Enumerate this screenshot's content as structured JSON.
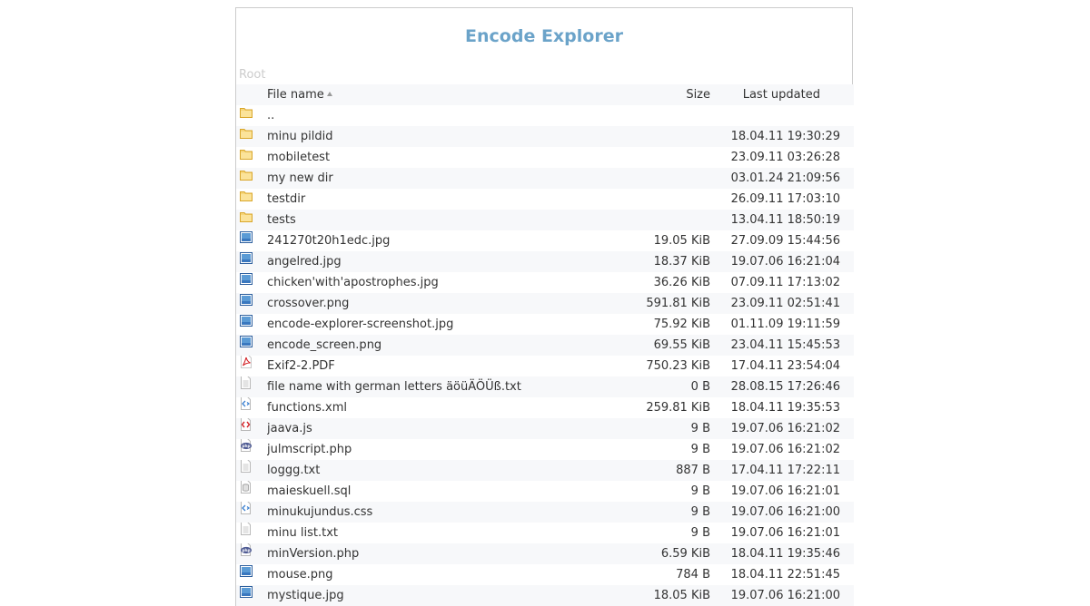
{
  "app": {
    "title": "Encode Explorer"
  },
  "breadcrumb": {
    "root_label": "Root"
  },
  "table": {
    "columns": {
      "name": "File name",
      "size": "Size",
      "date": "Last updated"
    },
    "sort_column": "name",
    "sort_direction": "asc",
    "rows": [
      {
        "icon": "folder-icon",
        "name": "..",
        "size": "",
        "date": ""
      },
      {
        "icon": "folder-icon",
        "name": "minu pildid",
        "size": "",
        "date": "18.04.11 19:30:29"
      },
      {
        "icon": "folder-icon",
        "name": "mobiletest",
        "size": "",
        "date": "23.09.11 03:26:28"
      },
      {
        "icon": "folder-icon",
        "name": "my new dir",
        "size": "",
        "date": "03.01.24 21:09:56"
      },
      {
        "icon": "folder-icon",
        "name": "testdir",
        "size": "",
        "date": "26.09.11 17:03:10"
      },
      {
        "icon": "folder-icon",
        "name": "tests",
        "size": "",
        "date": "13.04.11 18:50:19"
      },
      {
        "icon": "image-file-icon",
        "name": "241270t20h1edc.jpg",
        "size": "19.05 KiB",
        "date": "27.09.09 15:44:56"
      },
      {
        "icon": "image-file-icon",
        "name": "angelred.jpg",
        "size": "18.37 KiB",
        "date": "19.07.06 16:21:04"
      },
      {
        "icon": "image-file-icon",
        "name": "chicken'with'apostrophes.jpg",
        "size": "36.26 KiB",
        "date": "07.09.11 17:13:02"
      },
      {
        "icon": "image-file-icon",
        "name": "crossover.png",
        "size": "591.81 KiB",
        "date": "23.09.11 02:51:41"
      },
      {
        "icon": "image-file-icon",
        "name": "encode-explorer-screenshot.jpg",
        "size": "75.92 KiB",
        "date": "01.11.09 19:11:59"
      },
      {
        "icon": "image-file-icon",
        "name": "encode_screen.png",
        "size": "69.55 KiB",
        "date": "23.04.11 15:45:53"
      },
      {
        "icon": "pdf-file-icon",
        "name": "Exif2-2.PDF",
        "size": "750.23 KiB",
        "date": "17.04.11 23:54:04"
      },
      {
        "icon": "text-file-icon",
        "name": "file name with german letters äöüÄÖÜß.txt",
        "size": "0 B",
        "date": "28.08.15 17:26:46"
      },
      {
        "icon": "markup-file-icon",
        "name": "functions.xml",
        "size": "259.81 KiB",
        "date": "18.04.11 19:35:53"
      },
      {
        "icon": "script-file-icon",
        "name": "jaava.js",
        "size": "9 B",
        "date": "19.07.06 16:21:02"
      },
      {
        "icon": "php-file-icon",
        "name": "julmscript.php",
        "size": "9 B",
        "date": "19.07.06 16:21:02"
      },
      {
        "icon": "text-file-icon",
        "name": "loggg.txt",
        "size": "887 B",
        "date": "17.04.11 17:22:11"
      },
      {
        "icon": "database-file-icon",
        "name": "maieskuell.sql",
        "size": "9 B",
        "date": "19.07.06 16:21:01"
      },
      {
        "icon": "markup-file-icon",
        "name": "minukujundus.css",
        "size": "9 B",
        "date": "19.07.06 16:21:00"
      },
      {
        "icon": "text-file-icon",
        "name": "minu list.txt",
        "size": "9 B",
        "date": "19.07.06 16:21:01"
      },
      {
        "icon": "php-file-icon",
        "name": "minVersion.php",
        "size": "6.59 KiB",
        "date": "18.04.11 19:35:46"
      },
      {
        "icon": "image-file-icon",
        "name": "mouse.png",
        "size": "784 B",
        "date": "18.04.11 22:51:45"
      },
      {
        "icon": "image-file-icon",
        "name": "mystique.jpg",
        "size": "18.05 KiB",
        "date": "19.07.06 16:21:00"
      }
    ]
  }
}
